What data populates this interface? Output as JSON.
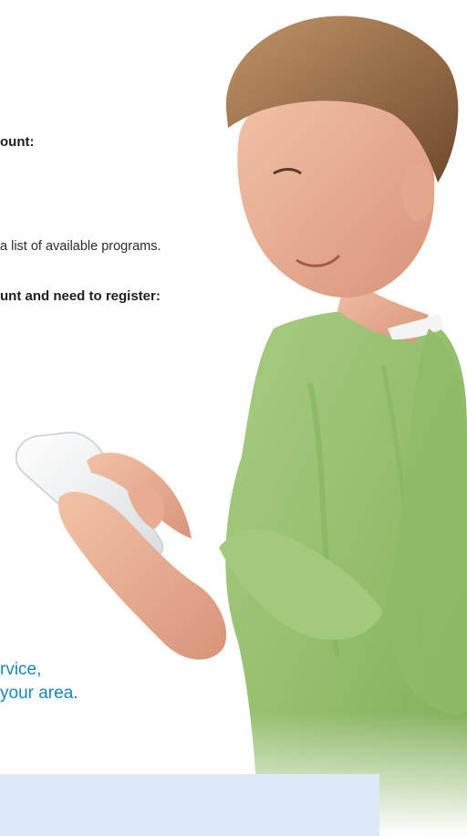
{
  "page": {
    "heading_account": "ount:",
    "programs_text": "a list of available programs.",
    "heading_register": "unt and need to register:",
    "blue_line_1": "rvice,",
    "blue_line_2": "your area."
  },
  "colors": {
    "accent_blue": "#1a86c6",
    "box_blue": "#dde9f7",
    "sweater_green": "#9cc277"
  }
}
